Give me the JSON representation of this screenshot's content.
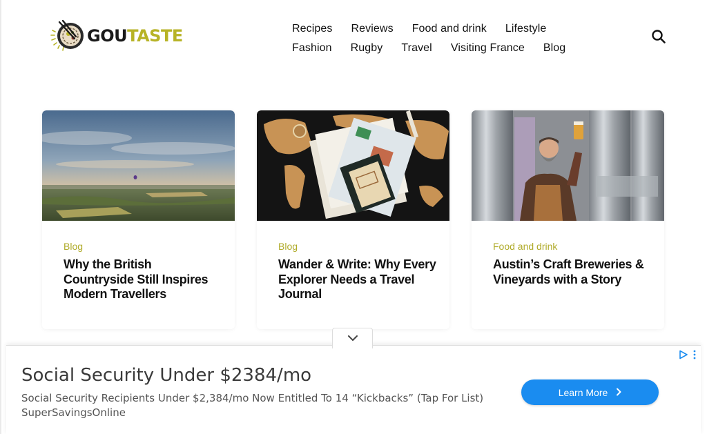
{
  "header": {
    "logo": {
      "prefix": "GOU",
      "suffix": "TASTE",
      "brand_color": "#b7b326"
    },
    "nav_rows": [
      [
        "Recipes",
        "Reviews",
        "Food and drink",
        "Lifestyle"
      ],
      [
        "Fashion",
        "Rugby",
        "Travel",
        "Visiting France",
        "Blog"
      ]
    ],
    "search_icon": "search-icon"
  },
  "cards": [
    {
      "category": "Blog",
      "title": "Why the British Countryside Still Inspires Modern Travellers",
      "image": "countryside-balloon-photo"
    },
    {
      "category": "Blog",
      "title": "Wander & Write: Why Every Explorer Needs a Travel Journal",
      "image": "world-map-journal-photo"
    },
    {
      "category": "Food and drink",
      "title": "Austin’s Craft Breweries & Vineyards with a Story",
      "image": "brewer-with-beer-photo"
    }
  ],
  "ad": {
    "headline": "Social Security Under $2384/mo",
    "description": "Social Security Recipients Under $2,384/mo Now Entitled To 14 “Kickbacks” (Tap For List)",
    "source": "SuperSavingsOnline",
    "cta": "Learn More",
    "cta_color": "#1a8cf0",
    "icons": [
      "chevron-down-icon",
      "adchoices-icon",
      "more-vertical-icon",
      "chevron-right-icon"
    ]
  }
}
